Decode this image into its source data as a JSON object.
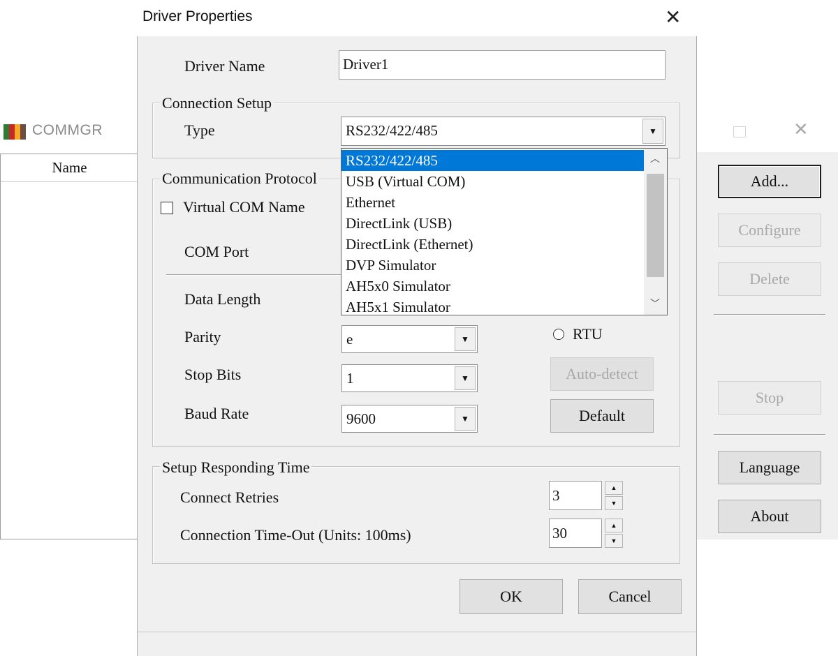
{
  "background_window": {
    "title": "COMMGR",
    "column_header": "Name",
    "buttons": {
      "add": "Add...",
      "configure": "Configure",
      "delete": "Delete",
      "stop": "Stop",
      "language": "Language",
      "about": "About"
    },
    "close_glyph": "✕"
  },
  "dialog": {
    "title": "Driver Properties",
    "close_glyph": "✕",
    "driver_name_label": "Driver Name",
    "driver_name_value": "Driver1",
    "connection_setup": {
      "legend": "Connection Setup",
      "type_label": "Type",
      "type_value": "RS232/422/485",
      "type_options": [
        "RS232/422/485",
        "USB (Virtual COM)",
        "Ethernet",
        "DirectLink (USB)",
        "DirectLink (Ethernet)",
        "DVP Simulator",
        "AH5x0 Simulator",
        "AH5x1 Simulator"
      ]
    },
    "communication_protocol": {
      "legend": "Communication Protocol",
      "virtual_com_label": "Virtual COM Name",
      "com_port_label": "COM Port",
      "data_length_label": "Data Length",
      "parity_label": "Parity",
      "parity_value": "e",
      "stop_bits_label": "Stop Bits",
      "stop_bits_value": "1",
      "baud_rate_label": "Baud Rate",
      "baud_rate_value": "9600",
      "rtu_label": "RTU",
      "auto_detect_label": "Auto-detect",
      "default_label": "Default"
    },
    "responding_time": {
      "legend": "Setup Responding Time",
      "connect_retries_label": "Connect Retries",
      "connect_retries_value": "3",
      "timeout_label": "Connection Time-Out (Units: 100ms)",
      "timeout_value": "30"
    },
    "ok_label": "OK",
    "cancel_label": "Cancel"
  },
  "colors": {
    "selection": "#0078d7",
    "dialog_bg": "#f0f0f0"
  }
}
